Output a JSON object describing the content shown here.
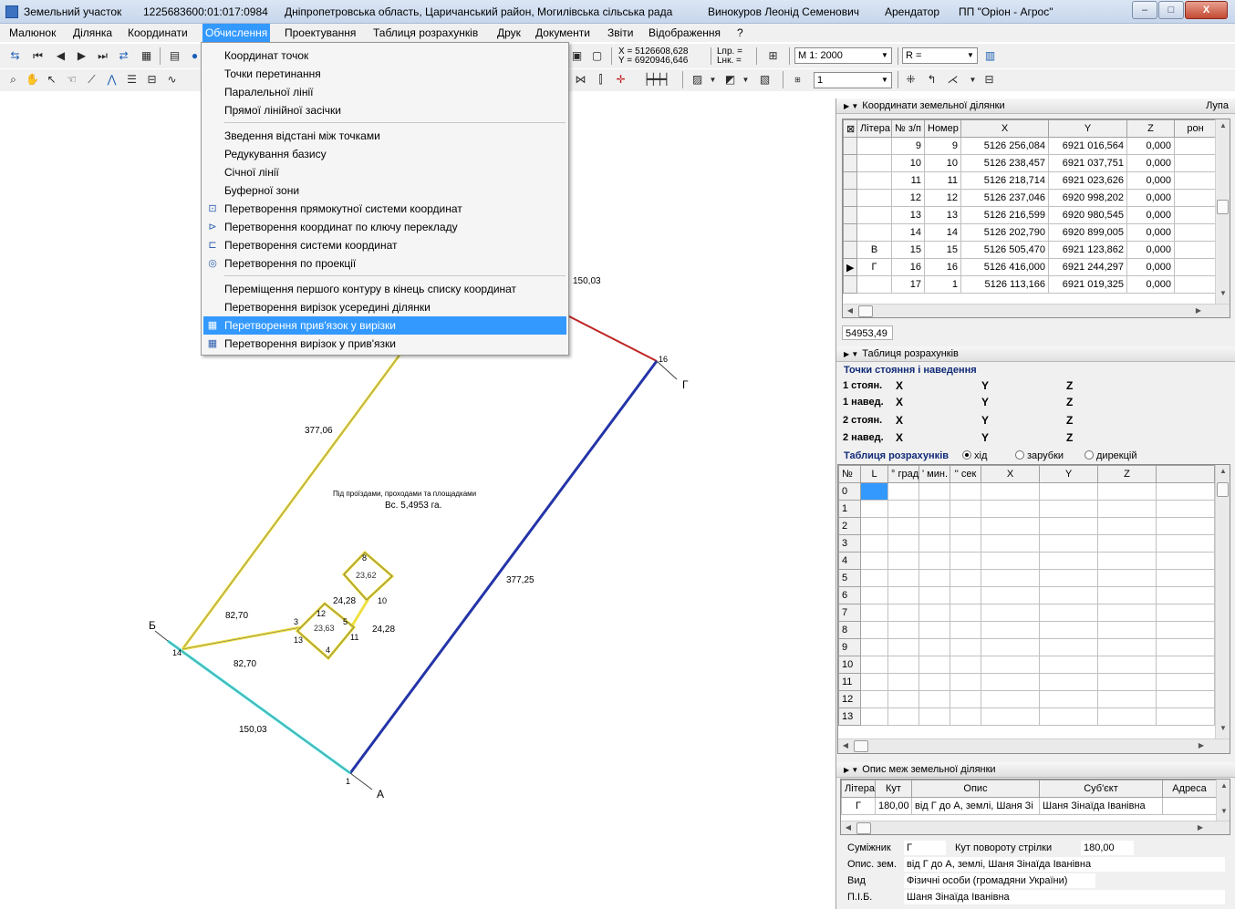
{
  "title_bar": {
    "app": "Земельний участок",
    "cadastral": "1225683600:01:017:0984",
    "location": "Дніпропетровська область, Царичанський район, Могилівська сільська рада",
    "owner": "Винокуров Леонід Семенович",
    "role": "Арендатор",
    "company": "ПП \"Оріон - Агрос\"",
    "btn_min": "–",
    "btn_max": "□",
    "btn_close": "X"
  },
  "menu": [
    "Малюнок",
    "Ділянка",
    "Координати",
    "Обчислення",
    "Проектування",
    "Таблиця розрахунків",
    "Друк",
    "Документи",
    "Звіти",
    "Відображення",
    "?"
  ],
  "toolbar": {
    "x_readout": "X = 5126608,628",
    "y_readout": "Y = 6920946,646",
    "lpr": "Lпр. =",
    "lnk": "Lнк. =",
    "scale": "M 1: 2000",
    "r_field": "R =",
    "layer_value": "1"
  },
  "dropdown": {
    "items": [
      {
        "label": "Координат точок",
        "icon": ""
      },
      {
        "label": "Точки перетинання",
        "icon": ""
      },
      {
        "label": "Паралельної лінії",
        "icon": ""
      },
      {
        "label": "Прямої лінійної засічки",
        "icon": ""
      },
      {
        "label": "Зведення відстані між точками",
        "icon": ""
      },
      {
        "label": "Редукування базису",
        "icon": ""
      },
      {
        "label": "Січної лінії",
        "icon": ""
      },
      {
        "label": "Буферної зони",
        "icon": ""
      },
      {
        "label": "Перетворення прямокутної системи координат",
        "icon": "coord-system-icon"
      },
      {
        "label": "Перетворення координат по ключу перекладу",
        "icon": "key-transform-icon"
      },
      {
        "label": "Перетворення системи координат",
        "icon": "system-transform-icon"
      },
      {
        "label": "Перетворення по проекції",
        "icon": "projection-icon"
      },
      {
        "label": "Переміщення першого контуру в кінець списку координат",
        "icon": ""
      },
      {
        "label": "Перетворення вирізок усередині ділянки",
        "icon": ""
      },
      {
        "label": "Перетворення прив'язок у вирізки",
        "icon": "binding-to-cutout-icon"
      },
      {
        "label": "Перетворення вирізок у прив'язки",
        "icon": "cutout-to-binding-icon"
      }
    ]
  },
  "drawing": {
    "labels": {
      "side_top": "150,03",
      "side_left": "377,06",
      "side_right": "377,25",
      "side_bottom": "150,03",
      "b1": "82,70",
      "b2": "82,70",
      "c1": "24,28",
      "c2": "24,28",
      "pt_A": "А",
      "pt_B": "Б",
      "pt_G": "Г",
      "n1": "1",
      "n14": "14",
      "n16": "16",
      "n3": "3",
      "n4": "4",
      "n5": "5",
      "n8": "8",
      "n10": "10",
      "n11": "11",
      "n12": "12",
      "n13": "13",
      "area_caption": "Під проїздами, проходами та площадками",
      "area_value": "Вс. 5,4953 га."
    }
  },
  "coords_panel": {
    "title": "Координати земельної ділянки",
    "lupa": "Лупа",
    "headers": [
      "",
      "Літера",
      "№ з/п",
      "Номер",
      "X",
      "Y",
      "Z",
      "рон"
    ],
    "rows": [
      {
        "marker": "",
        "litera": "",
        "n": "9",
        "num": "9",
        "x": "5126 256,084",
        "y": "6921 016,564",
        "z": "0,000"
      },
      {
        "marker": "",
        "litera": "",
        "n": "10",
        "num": "10",
        "x": "5126 238,457",
        "y": "6921 037,751",
        "z": "0,000"
      },
      {
        "marker": "",
        "litera": "",
        "n": "11",
        "num": "11",
        "x": "5126 218,714",
        "y": "6921 023,626",
        "z": "0,000"
      },
      {
        "marker": "",
        "litera": "",
        "n": "12",
        "num": "12",
        "x": "5126 237,046",
        "y": "6920 998,202",
        "z": "0,000"
      },
      {
        "marker": "",
        "litera": "",
        "n": "13",
        "num": "13",
        "x": "5126 216,599",
        "y": "6920 980,545",
        "z": "0,000"
      },
      {
        "marker": "",
        "litera": "",
        "n": "14",
        "num": "14",
        "x": "5126 202,790",
        "y": "6920 899,005",
        "z": "0,000"
      },
      {
        "marker": "",
        "litera": "В",
        "n": "15",
        "num": "15",
        "x": "5126 505,470",
        "y": "6921 123,862",
        "z": "0,000"
      },
      {
        "marker": "▶",
        "litera": "Г",
        "n": "16",
        "num": "16",
        "x": "5126 416,000",
        "y": "6921 244,297",
        "z": "0,000"
      },
      {
        "marker": "",
        "litera": "",
        "n": "17",
        "num": "1",
        "x": "5126 113,166",
        "y": "6921 019,325",
        "z": "0,000"
      }
    ],
    "status": "54953,49"
  },
  "calc_panel": {
    "title": "Таблиця розрахунків",
    "section": "Точки стояння і наведення",
    "rows": [
      {
        "label": "1 стоян.",
        "x": "X",
        "y": "Y",
        "z": "Z"
      },
      {
        "label": "1 навед.",
        "x": "X",
        "y": "Y",
        "z": "Z"
      },
      {
        "label": "2 стоян.",
        "x": "X",
        "y": "Y",
        "z": "Z"
      },
      {
        "label": "2 навед.",
        "x": "X",
        "y": "Y",
        "z": "Z"
      }
    ],
    "table_label": "Таблиця розрахунків",
    "radio_options": [
      "хід",
      "зарубки",
      "дирекцій"
    ],
    "headers": [
      "№",
      "L",
      "° град",
      "' мин.",
      "'' сек",
      "X",
      "Y",
      "Z"
    ],
    "row_numbers": [
      "0",
      "1",
      "2",
      "3",
      "4",
      "5",
      "6",
      "7",
      "8",
      "9",
      "10",
      "11",
      "12",
      "13"
    ]
  },
  "bounds_panel": {
    "title": "Опис меж земельної ділянки",
    "headers": [
      "Літера",
      "Кут",
      "Опис",
      "Суб'єкт",
      "Адреса"
    ],
    "rows": [
      {
        "litera": "Г",
        "kut": "180,00",
        "opys": "від Г до А, землі, Шаня Зі",
        "subject": "Шаня Зінаїда Іванівна",
        "address": ""
      }
    ],
    "details": {
      "neighbor_label": "Суміжник",
      "neighbor_value": "Г",
      "arrow_angle_label": "Кут повороту стрілки",
      "arrow_angle_value": "180,00",
      "desc_label": "Опис. зем.",
      "desc_value": "від Г до А, землі, Шаня Зінаїда Іванівна",
      "type_label": "Вид",
      "type_value": "Фізичні особи (громадяни України)",
      "name_label": "П.І.Б.",
      "name_value": "Шаня Зінаїда Іванівна"
    }
  }
}
